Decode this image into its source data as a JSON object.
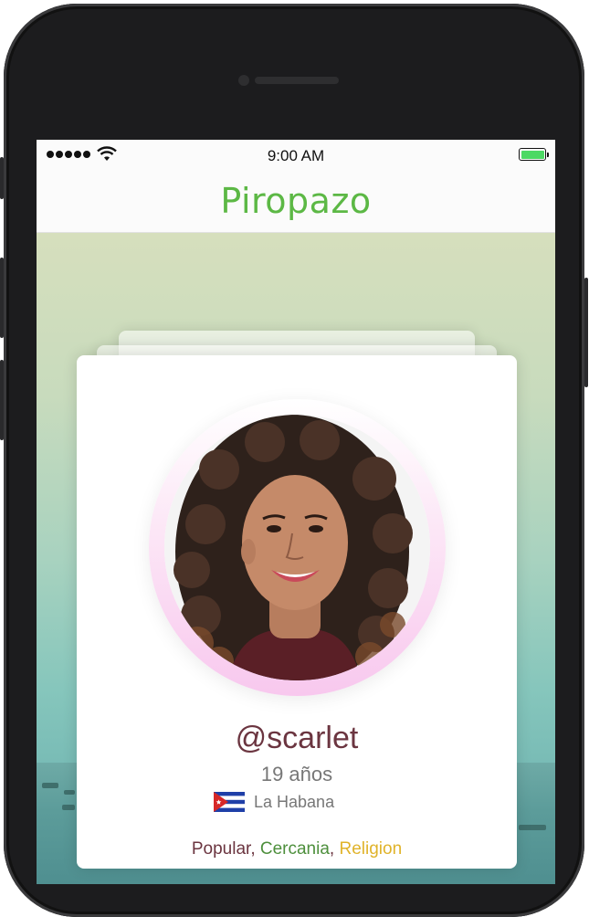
{
  "status_bar": {
    "time": "9:00 AM",
    "battery_color": "#4cd964"
  },
  "app": {
    "title": "Piropazo",
    "brand_color": "#5cb845"
  },
  "profile": {
    "username": "@scarlet",
    "age": "19 años",
    "location": "La Habana",
    "flag_icon": "cuba-flag-icon",
    "tags": [
      {
        "label": "Popular",
        "color": "#6b3540"
      },
      {
        "label": "Cercania",
        "color": "#4d8f3c"
      },
      {
        "label": "Religion",
        "color": "#e0b32a"
      }
    ],
    "tag_separator": ", "
  }
}
